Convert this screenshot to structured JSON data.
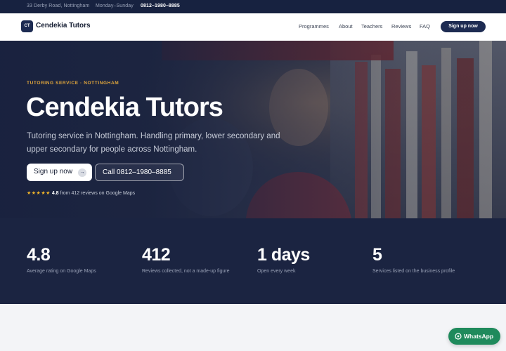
{
  "topbar": {
    "address": "33 Derby Road, Nottingham",
    "hours": "Monday–Sunday",
    "phone": "0812–1980–8885"
  },
  "nav": {
    "logo_initials": "CT",
    "brand": "Cendekia Tutors",
    "links": [
      "Programmes",
      "About",
      "Teachers",
      "Reviews",
      "FAQ"
    ],
    "cta": "Sign up now"
  },
  "hero": {
    "eyebrow": "TUTORING SERVICE · NOTTINGHAM",
    "title": "Cendekia Tutors",
    "subtitle": "Tutoring service in Nottingham. Handling primary, lower secondary and upper secondary for people across Nottingham.",
    "primary_cta": "Sign up now",
    "primary_cta_icon": "arrow-right-icon",
    "secondary_cta": "Call 0812–1980–8885",
    "rating_stars": "★★★★★",
    "rating_score": "4.8",
    "rating_text": "from 412 reviews on Google Maps"
  },
  "stats": [
    {
      "value": "4.8",
      "label": "Average rating on Google Maps"
    },
    {
      "value": "412",
      "label": "Reviews collected, not a made-up figure"
    },
    {
      "value": "1 days",
      "label": "Open every week"
    },
    {
      "value": "5",
      "label": "Services listed on the business profile"
    }
  ],
  "whatsapp": {
    "label": "WhatsApp",
    "icon": "whatsapp-icon"
  },
  "colors": {
    "navy": "#1d2b52",
    "dark_band": "#1b2441",
    "accent_gold": "#e0a63c",
    "star": "#f0b429",
    "whatsapp_green": "#1f8a5c"
  }
}
